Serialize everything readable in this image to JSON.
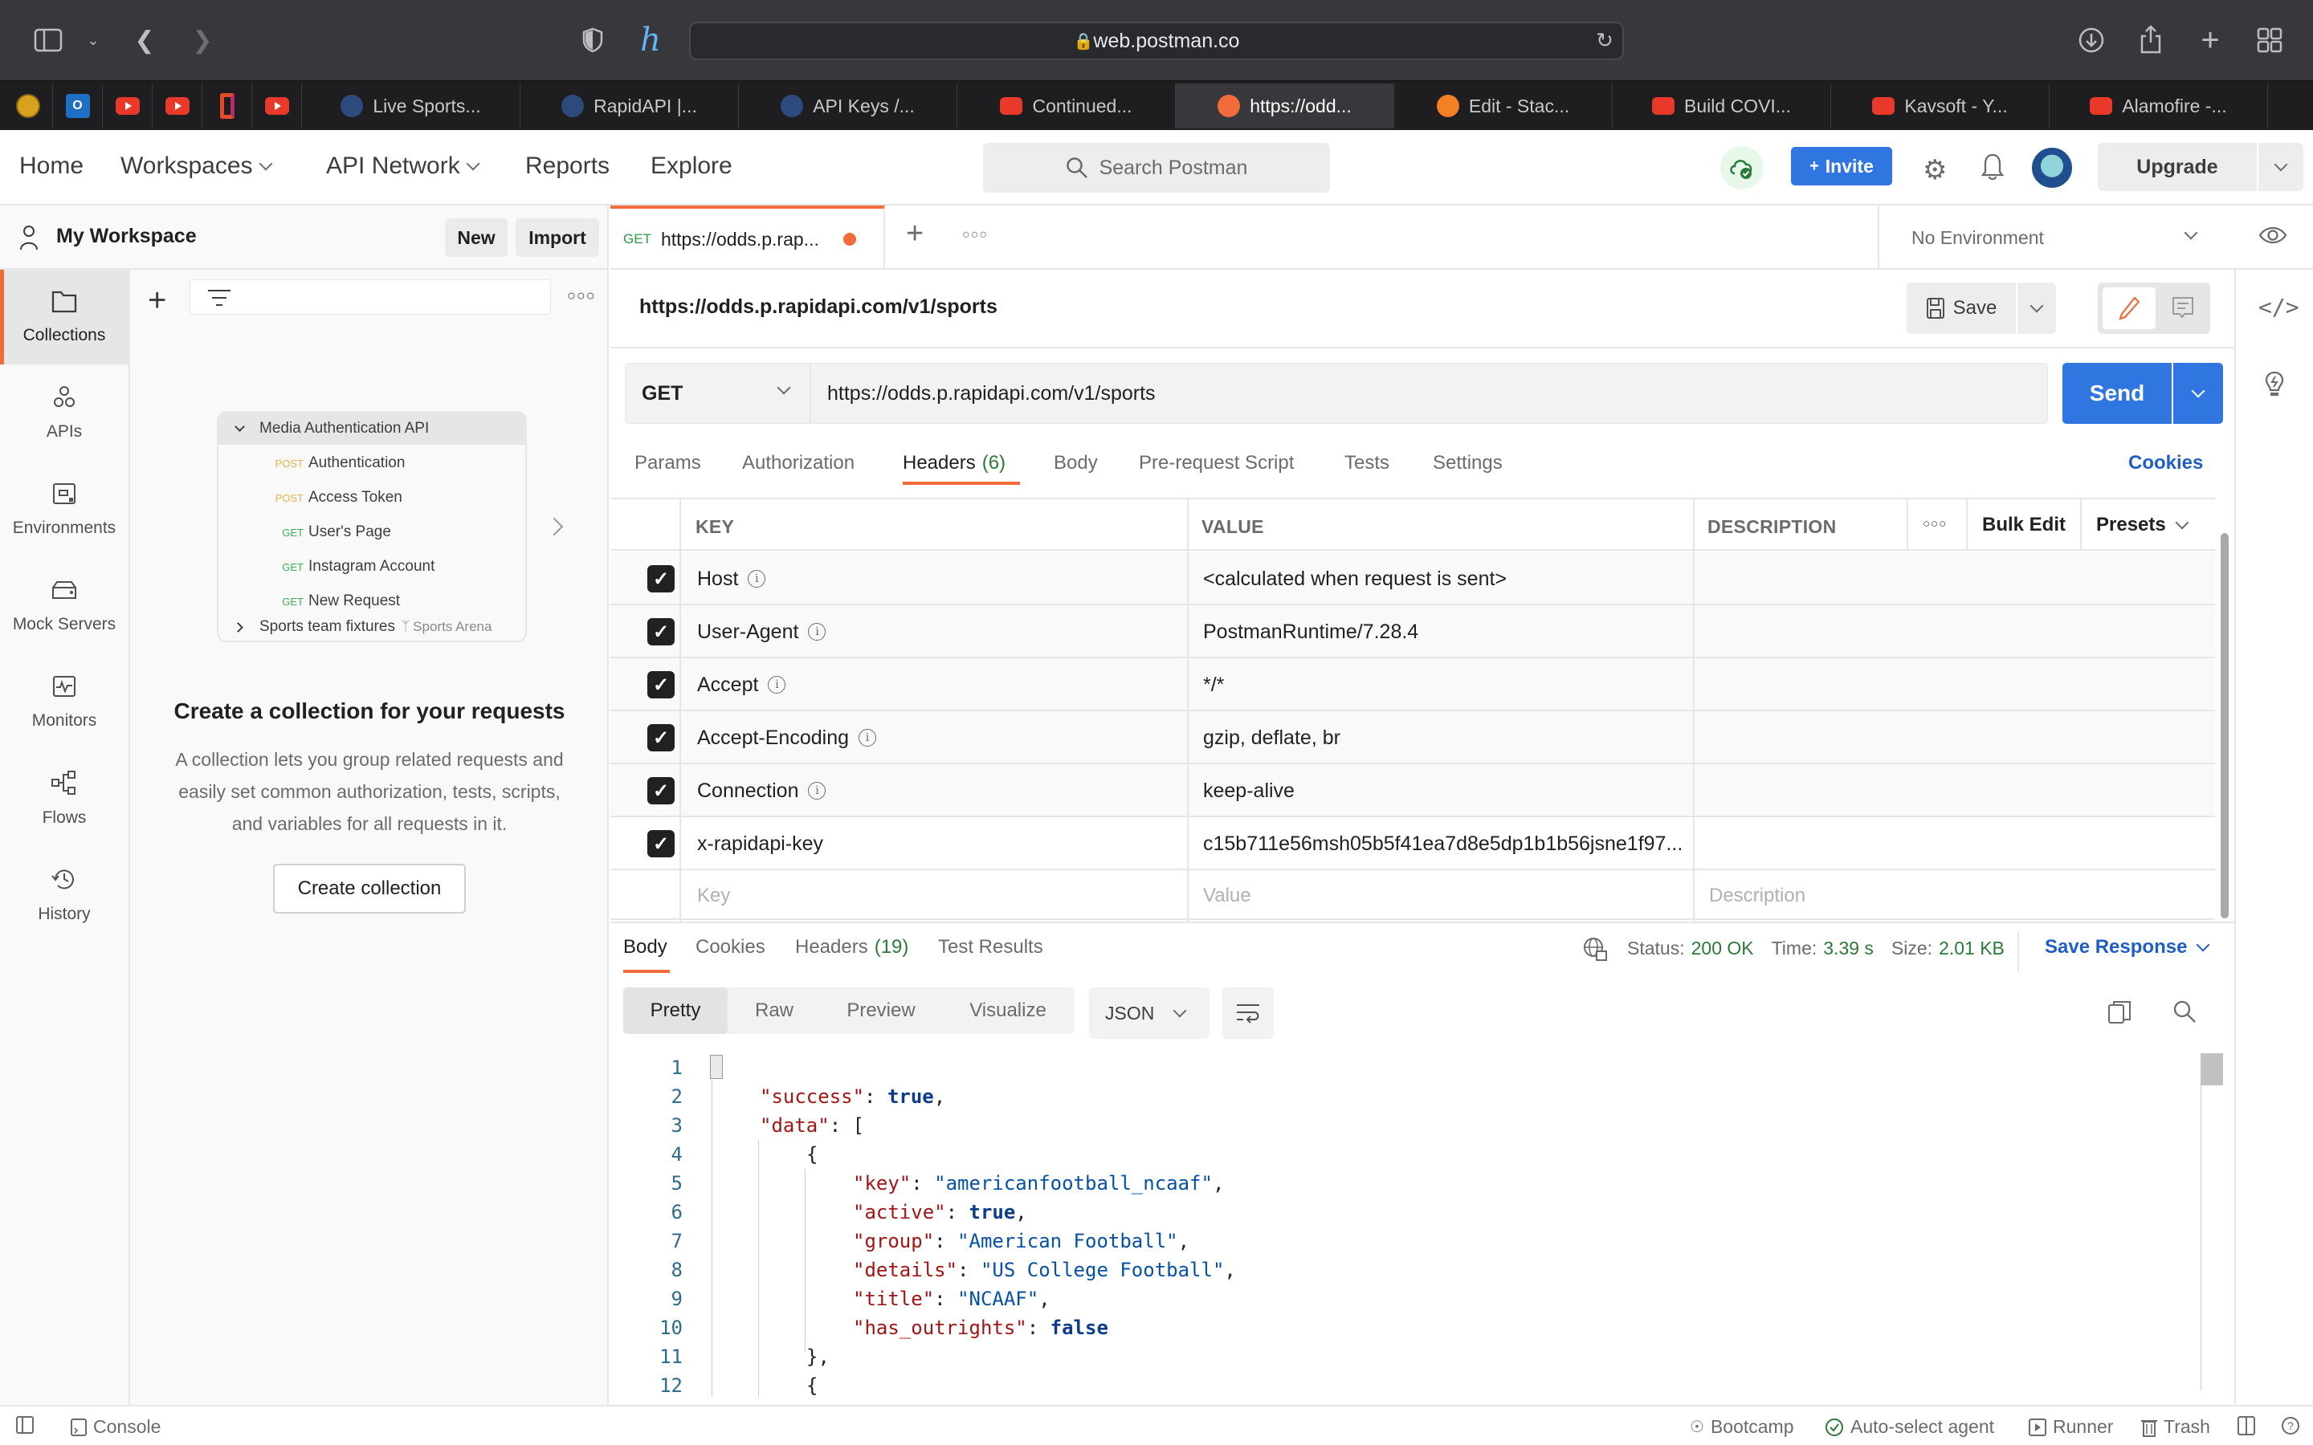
{
  "browser": {
    "address": "web.postman.co",
    "pinned_tabs": [
      "postgres-elephant",
      "outlook",
      "youtube",
      "youtube",
      "office",
      "youtube"
    ],
    "tabs": [
      {
        "label": "Live Sports...",
        "icon": "rapidapi-icon"
      },
      {
        "label": "RapidAPI |...",
        "icon": "rapidapi-icon"
      },
      {
        "label": "API Keys /...",
        "icon": "rapidapi-icon"
      },
      {
        "label": "Continued...",
        "icon": "youtube-icon"
      },
      {
        "label": "https://odd...",
        "icon": "postman-icon",
        "active": true
      },
      {
        "label": "Edit - Stac...",
        "icon": "stackoverflow-icon"
      },
      {
        "label": "Build COVI...",
        "icon": "youtube-icon"
      },
      {
        "label": "Kavsoft - Y...",
        "icon": "youtube-icon"
      },
      {
        "label": "Alamofire -...",
        "icon": "youtube-icon"
      }
    ]
  },
  "header": {
    "nav": [
      "Home",
      "Workspaces",
      "API Network",
      "Reports",
      "Explore"
    ],
    "search_placeholder": "Search Postman",
    "invite": "Invite",
    "upgrade": "Upgrade"
  },
  "workspace": {
    "title": "My Workspace",
    "new": "New",
    "import": "Import"
  },
  "sidebar": {
    "items": [
      "Collections",
      "APIs",
      "Environments",
      "Mock Servers",
      "Monitors",
      "Flows",
      "History"
    ],
    "active": "Collections"
  },
  "collections": {
    "illustration": {
      "folder": "Media Authentication API",
      "requests": [
        {
          "method": "POST",
          "name": "Authentication"
        },
        {
          "method": "POST",
          "name": "Access Token"
        },
        {
          "method": "GET",
          "name": "User's Page"
        },
        {
          "method": "GET",
          "name": "Instagram Account"
        },
        {
          "method": "GET",
          "name": "New Request"
        }
      ],
      "fork_name": "Sports team fixtures",
      "fork_source": "Sports Arena"
    },
    "empty_title": "Create a collection for your requests",
    "empty_desc_1": "A collection lets you group related requests and",
    "empty_desc_2": "easily set common authorization, tests, scripts,",
    "empty_desc_3": "and variables for all requests in it.",
    "create_button": "Create collection"
  },
  "request_tab": {
    "method": "GET",
    "label": "https://odds.p.rap..."
  },
  "environment": "No Environment",
  "request": {
    "title": "https://odds.p.rapidapi.com/v1/sports",
    "save": "Save",
    "method": "GET",
    "url": "https://odds.p.rapidapi.com/v1/sports",
    "send": "Send",
    "tabs": [
      "Params",
      "Authorization",
      "Headers",
      "Body",
      "Pre-request Script",
      "Tests",
      "Settings"
    ],
    "headers_count": "(6)",
    "cookies": "Cookies"
  },
  "headers_table": {
    "columns": [
      "KEY",
      "VALUE",
      "DESCRIPTION"
    ],
    "bulk_edit": "Bulk Edit",
    "presets": "Presets",
    "rows": [
      {
        "key": "Host",
        "value": "<calculated when request is sent>",
        "info": true,
        "checked": true
      },
      {
        "key": "User-Agent",
        "value": "PostmanRuntime/7.28.4",
        "info": true,
        "checked": true
      },
      {
        "key": "Accept",
        "value": "*/*",
        "info": true,
        "checked": true
      },
      {
        "key": "Accept-Encoding",
        "value": "gzip, deflate, br",
        "info": true,
        "checked": true
      },
      {
        "key": "Connection",
        "value": "keep-alive",
        "info": true,
        "checked": true
      },
      {
        "key": "x-rapidapi-key",
        "value": "c15b711e56msh05b5f41ea7d8e5dp1b1b56jsne1f97...",
        "info": false,
        "checked": true
      }
    ],
    "placeholders": {
      "key": "Key",
      "value": "Value",
      "description": "Description"
    }
  },
  "response": {
    "tabs": [
      "Body",
      "Cookies",
      "Headers",
      "Test Results"
    ],
    "headers_count": "(19)",
    "status_label": "Status:",
    "status": "200 OK",
    "time_label": "Time:",
    "time": "3.39 s",
    "size_label": "Size:",
    "size": "2.01 KB",
    "save_response": "Save Response",
    "views": [
      "Pretty",
      "Raw",
      "Preview",
      "Visualize"
    ],
    "format": "JSON",
    "lines": [
      {
        "n": "1",
        "indent": 0,
        "parts": [
          [
            "p",
            "{"
          ]
        ]
      },
      {
        "n": "2",
        "indent": 1,
        "parts": [
          [
            "k",
            "\"success\""
          ],
          [
            "p",
            ": "
          ],
          [
            "b",
            "true"
          ],
          [
            "p",
            ","
          ]
        ]
      },
      {
        "n": "3",
        "indent": 1,
        "parts": [
          [
            "k",
            "\"data\""
          ],
          [
            "p",
            ": ["
          ]
        ]
      },
      {
        "n": "4",
        "indent": 2,
        "parts": [
          [
            "p",
            "{"
          ]
        ]
      },
      {
        "n": "5",
        "indent": 3,
        "parts": [
          [
            "k",
            "\"key\""
          ],
          [
            "p",
            ": "
          ],
          [
            "s",
            "\"americanfootball_ncaaf\""
          ],
          [
            "p",
            ","
          ]
        ]
      },
      {
        "n": "6",
        "indent": 3,
        "parts": [
          [
            "k",
            "\"active\""
          ],
          [
            "p",
            ": "
          ],
          [
            "b",
            "true"
          ],
          [
            "p",
            ","
          ]
        ]
      },
      {
        "n": "7",
        "indent": 3,
        "parts": [
          [
            "k",
            "\"group\""
          ],
          [
            "p",
            ": "
          ],
          [
            "s",
            "\"American Football\""
          ],
          [
            "p",
            ","
          ]
        ]
      },
      {
        "n": "8",
        "indent": 3,
        "parts": [
          [
            "k",
            "\"details\""
          ],
          [
            "p",
            ": "
          ],
          [
            "s",
            "\"US College Football\""
          ],
          [
            "p",
            ","
          ]
        ]
      },
      {
        "n": "9",
        "indent": 3,
        "parts": [
          [
            "k",
            "\"title\""
          ],
          [
            "p",
            ": "
          ],
          [
            "s",
            "\"NCAAF\""
          ],
          [
            "p",
            ","
          ]
        ]
      },
      {
        "n": "10",
        "indent": 3,
        "parts": [
          [
            "k",
            "\"has_outrights\""
          ],
          [
            "p",
            ": "
          ],
          [
            "b",
            "false"
          ]
        ]
      },
      {
        "n": "11",
        "indent": 2,
        "parts": [
          [
            "p",
            "},"
          ]
        ]
      },
      {
        "n": "12",
        "indent": 2,
        "parts": [
          [
            "p",
            "{"
          ]
        ]
      }
    ]
  },
  "footer": {
    "console": "Console",
    "bootcamp": "Bootcamp",
    "agent": "Auto-select agent",
    "runner": "Runner",
    "trash": "Trash"
  }
}
